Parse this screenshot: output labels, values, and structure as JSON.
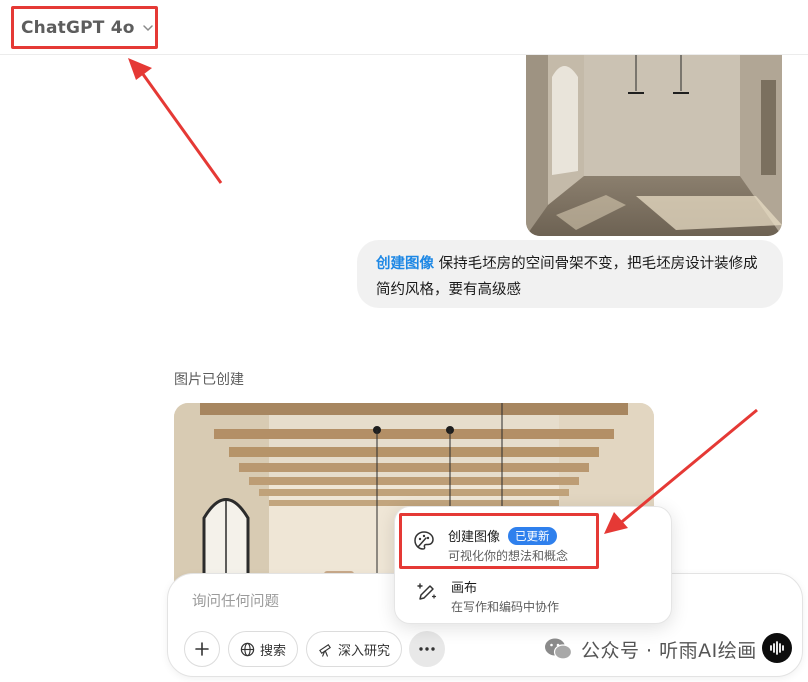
{
  "header": {
    "model_name": "ChatGPT 4o",
    "chevron_icon": "chevron-down-icon"
  },
  "user_message": {
    "tag": "创建图像",
    "text": " 保持毛坯房的空间骨架不变，把毛坯房设计装修成简约风格，要有高级感"
  },
  "assistant": {
    "created_label": "图片已创建"
  },
  "composer": {
    "placeholder": "询问任何问题",
    "buttons": {
      "plus_icon": "plus-icon",
      "search_label": "搜索",
      "search_icon": "globe-icon",
      "research_label": "深入研究",
      "research_icon": "telescope-icon",
      "more_icon": "more-dots-icon"
    }
  },
  "tools_menu": {
    "items": [
      {
        "title": "创建图像",
        "badge": "已更新",
        "desc": "可视化你的想法和概念",
        "icon": "palette-icon"
      },
      {
        "title": "画布",
        "desc": "在写作和编码中协作",
        "icon": "pen-sparkle-icon"
      }
    ]
  },
  "watermark": {
    "text": "公众号 · 听雨AI绘画"
  },
  "colors": {
    "annotation_red": "#e53935",
    "tag_blue": "#1e88e5",
    "badge_blue": "#2f80ed",
    "bubble_bg": "#f1f1f1"
  }
}
